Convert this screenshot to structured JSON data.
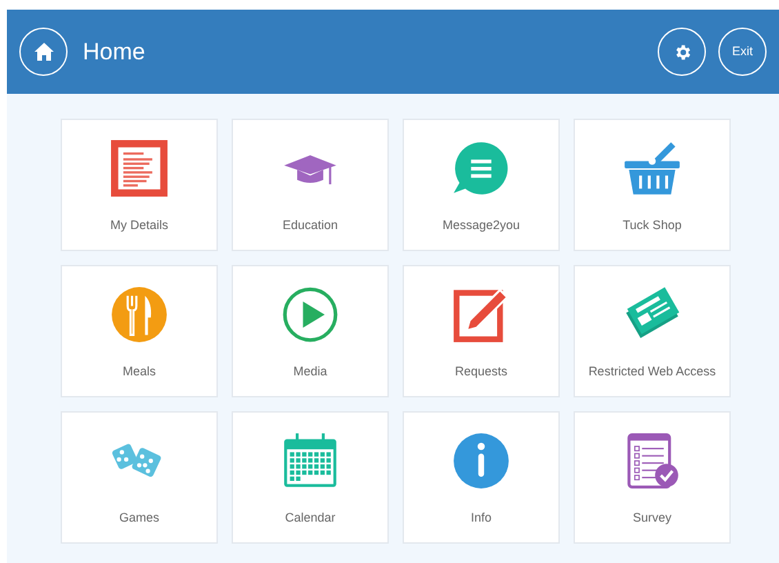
{
  "header": {
    "title": "Home",
    "exit_label": "Exit"
  },
  "tiles": [
    {
      "kind": "details",
      "label": "My Details"
    },
    {
      "kind": "education",
      "label": "Education"
    },
    {
      "kind": "message",
      "label": "Message2you"
    },
    {
      "kind": "shop",
      "label": "Tuck Shop"
    },
    {
      "kind": "meals",
      "label": "Meals"
    },
    {
      "kind": "media",
      "label": "Media"
    },
    {
      "kind": "requests",
      "label": "Requests"
    },
    {
      "kind": "web",
      "label": "Restricted Web Access"
    },
    {
      "kind": "games",
      "label": "Games"
    },
    {
      "kind": "calendar",
      "label": "Calendar"
    },
    {
      "kind": "info",
      "label": "Info"
    },
    {
      "kind": "survey",
      "label": "Survey"
    }
  ]
}
